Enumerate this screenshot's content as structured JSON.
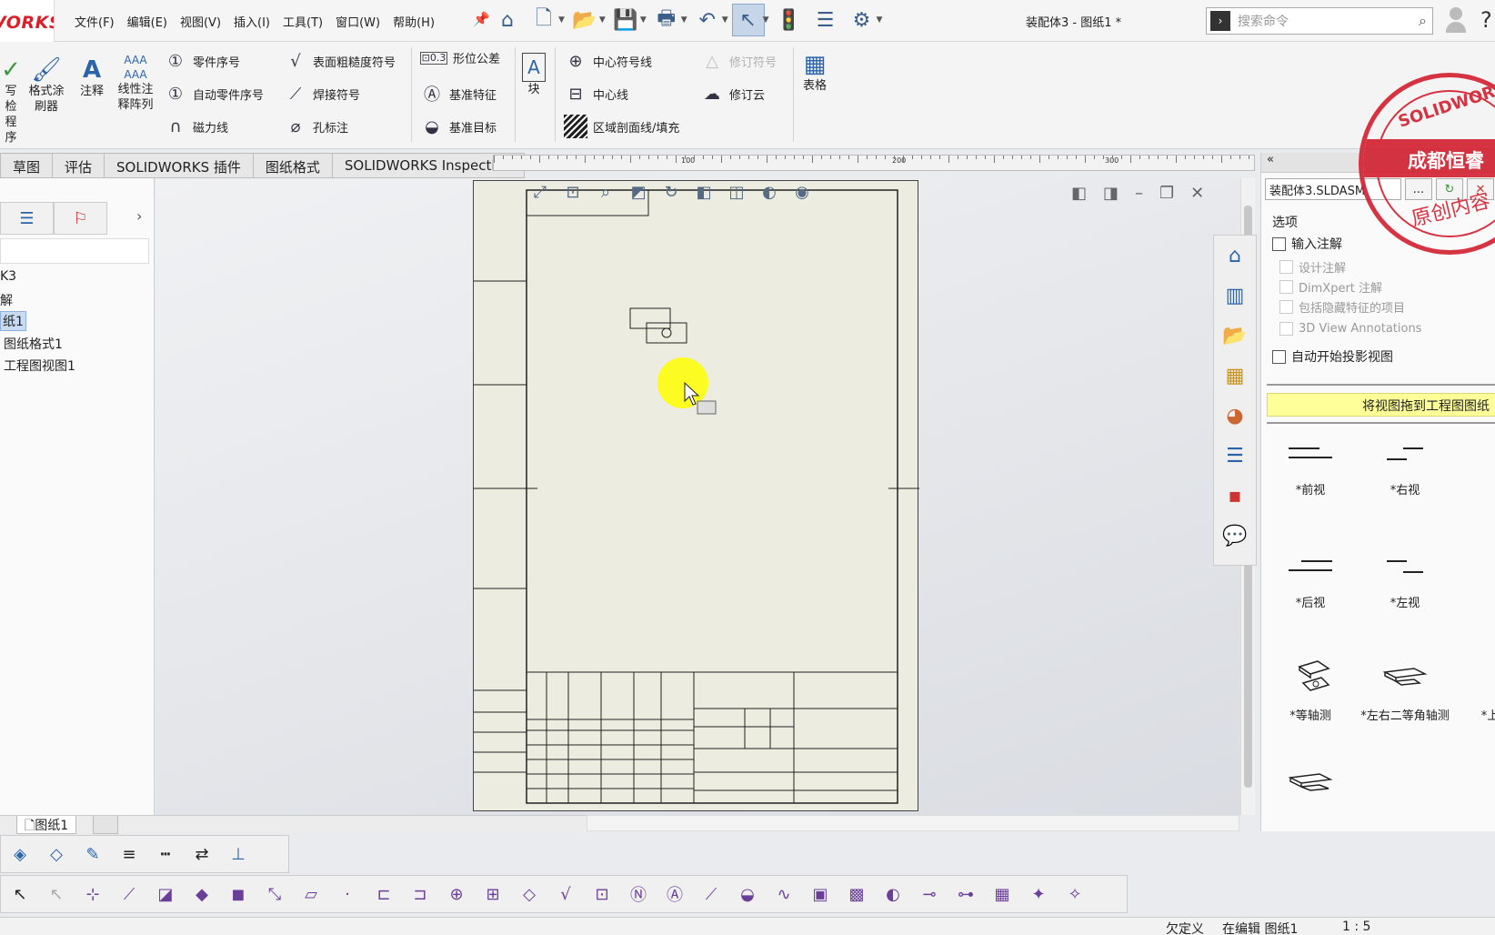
{
  "app": {
    "logo_text": "VORKS",
    "document_title": "装配体3 - 图纸1 *",
    "menus": [
      "文件(F)",
      "编辑(E)",
      "视图(V)",
      "插入(I)",
      "工具(T)",
      "窗口(W)",
      "帮助(H)"
    ],
    "search_placeholder": "搜索命令"
  },
  "ribbon": {
    "check_a": "写检",
    "check_b": "程序",
    "format_painter_a": "格式涂",
    "format_painter_b": "刷器",
    "note": "注释",
    "linear_note_a": "线性注",
    "linear_note_b": "释阵列",
    "balloon": "零件序号",
    "auto_balloon": "自动零件序号",
    "magnetic_line": "磁力线",
    "surface_finish": "表面粗糙度符号",
    "weld_symbol": "焊接符号",
    "hole_callout": "孔标注",
    "gtol": "形位公差",
    "datum_feature": "基准特征",
    "datum_target": "基准目标",
    "block": "块",
    "center_mark": "中心符号线",
    "centerline": "中心线",
    "area_hatch": "区域剖面线/填充",
    "revision_symbol": "修订符号",
    "revision_cloud": "修订云",
    "table": "表格"
  },
  "tabs": [
    "草图",
    "评估",
    "SOLIDWORKS 插件",
    "图纸格式",
    "SOLIDWORKS Inspection"
  ],
  "ruler_labels": [
    "100",
    "200",
    "300"
  ],
  "tree": {
    "items": [
      "K3",
      "解",
      "纸1",
      "图纸格式1",
      "工程图视图1"
    ]
  },
  "task_pane": {
    "assembly_combo": "装配体3.SLDASM",
    "browse_label": "...",
    "options_label": "选项",
    "import_annotations": "输入注解",
    "design_annotations": "设计注解",
    "dimxpert": "DimXpert 注解",
    "hidden_features": "包括隐藏特征的项目",
    "view_annotations": "3D View Annotations",
    "auto_projected": "自动开始投影视图",
    "drag_banner": "将视图拖到工程图图纸",
    "views": [
      {
        "label": "*前视"
      },
      {
        "label": "*右视"
      },
      {
        "label": "*后视"
      },
      {
        "label": "*左视"
      },
      {
        "label": "*等轴测"
      },
      {
        "label": "*左右二等角轴测"
      },
      {
        "label": "*上下"
      }
    ]
  },
  "watermark": {
    "top": "SOLIDWORKS",
    "band": "成都恒睿",
    "bottom": "原创内容"
  },
  "sheet_tab": "图纸1",
  "status": {
    "state": "欠定义",
    "editing": "在编辑 图纸1",
    "scale": "1 : 5"
  },
  "colors": {
    "brand_red": "#d21f2f",
    "accent_blue": "#2c64a9",
    "highlight_yellow": "#ffff99",
    "sheet": "#ecece0"
  }
}
